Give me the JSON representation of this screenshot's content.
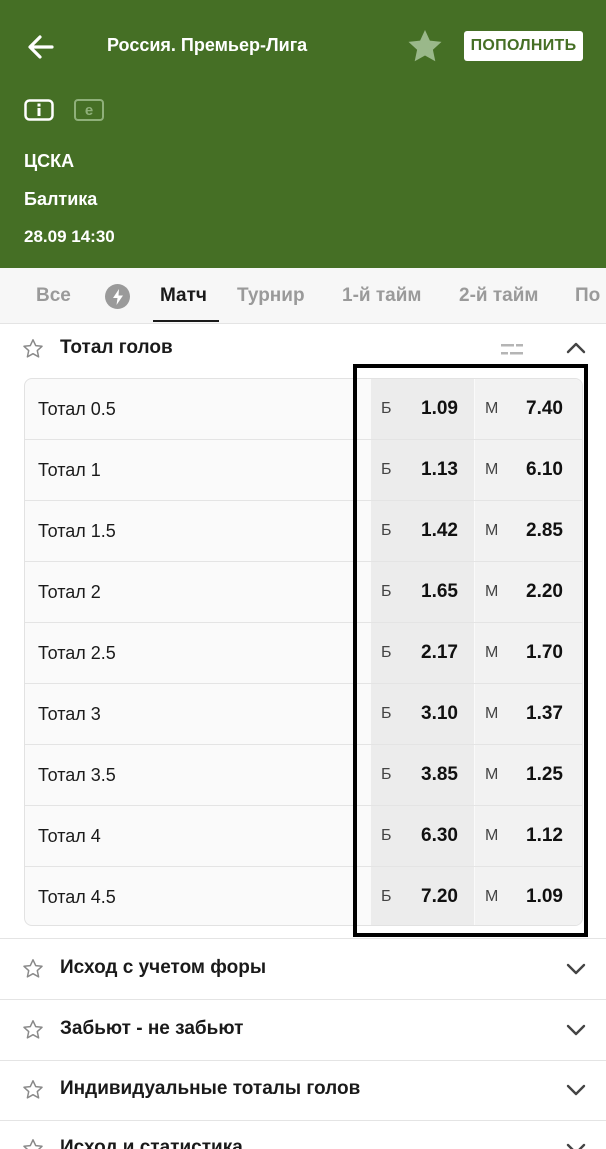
{
  "header": {
    "league": "Россия. Премьер-Лига",
    "deposit_label": "ПОПОЛНИТЬ",
    "team_home": "ЦСКА",
    "team_away": "Балтика",
    "datetime": "28.09 14:30",
    "e_icon_label": "e",
    "colors": {
      "background": "#456f25",
      "star": "#9ab88a"
    }
  },
  "tabs": [
    {
      "label": "Все",
      "active": false
    },
    {
      "label": "Матч",
      "active": true
    },
    {
      "label": "Турнир",
      "active": false
    },
    {
      "label": "1-й тайм",
      "active": false
    },
    {
      "label": "2-й тайм",
      "active": false
    },
    {
      "label": "По",
      "active": false
    }
  ],
  "totals_section": {
    "title": "Тотал голов",
    "over_letter": "Б",
    "under_letter": "М",
    "rows": [
      {
        "label": "Тотал 0.5",
        "over": "1.09",
        "under": "7.40"
      },
      {
        "label": "Тотал 1",
        "over": "1.13",
        "under": "6.10"
      },
      {
        "label": "Тотал 1.5",
        "over": "1.42",
        "under": "2.85"
      },
      {
        "label": "Тотал 2",
        "over": "1.65",
        "under": "2.20"
      },
      {
        "label": "Тотал 2.5",
        "over": "2.17",
        "under": "1.70"
      },
      {
        "label": "Тотал 3",
        "over": "3.10",
        "under": "1.37"
      },
      {
        "label": "Тотал 3.5",
        "over": "3.85",
        "under": "1.25"
      },
      {
        "label": "Тотал 4",
        "over": "6.30",
        "under": "1.12"
      },
      {
        "label": "Тотал 4.5",
        "over": "7.20",
        "under": "1.09"
      }
    ]
  },
  "collapsed_sections": [
    {
      "title": "Исход с учетом форы"
    },
    {
      "title": "Забьют - не забьют"
    },
    {
      "title": "Индивидуальные тоталы голов"
    },
    {
      "title": "Исход и статистика"
    }
  ]
}
